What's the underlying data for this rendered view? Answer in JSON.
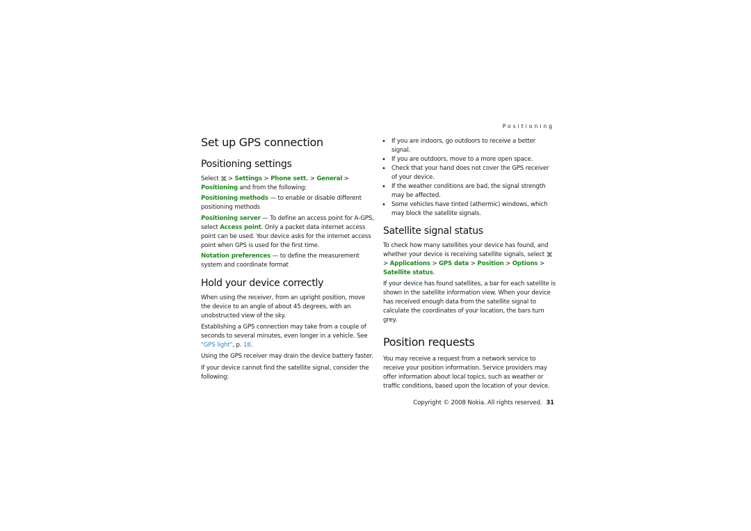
{
  "running_head": "Positioning",
  "left": {
    "title": "Set up GPS connection",
    "positioning_settings": {
      "heading": "Positioning settings",
      "select_word": "Select",
      "menu_icon": "menu-key-icon",
      "sep": ">",
      "path": [
        "Settings",
        "Phone sett.",
        "General",
        "Positioning"
      ],
      "path_tail": "and from the following:",
      "items": [
        {
          "term": "Positioning methods",
          "desc": " — to enable or disable different positioning methods"
        },
        {
          "term": "Positioning server",
          "desc_pre": " — To define an access point for A-GPS, select ",
          "inline_term": "Access point",
          "desc_post": ". Only a packet data internet access point can be used. Your device asks for the internet access point when GPS is used for the first time."
        },
        {
          "term": "Notation preferences",
          "desc": " — to define the measurement system and coordinate format"
        }
      ]
    },
    "hold_device": {
      "heading": "Hold your device correctly",
      "p1": "When using the receiver, from an upright position, move the device to an angle of about 45 degrees, with an unobstructed view of the sky.",
      "p2_pre": "Establishing a GPS connection may take from a couple of seconds to several minutes, even longer in a vehicle. See ",
      "p2_link": "\"GPS light\"",
      "p2_mid": ", p. ",
      "p2_page": "18",
      "p2_end": ".",
      "p3": "Using the GPS receiver may drain the device battery faster.",
      "p4": "If your device cannot find the satellite signal, consider the following:"
    }
  },
  "right": {
    "bullets": [
      "If you are indoors, go outdoors to receive a better signal.",
      "If you are outdoors, move to a more open space.",
      "Check that your hand does not cover the GPS receiver of your device.",
      "If the weather conditions are bad, the signal strength may be affected.",
      "Some vehicles have tinted (athermic) windows, which may block the satellite signals."
    ],
    "satellite": {
      "heading": "Satellite signal status",
      "p1": "To check how many satellites your device has found, and whether your device is receiving satellite signals, select",
      "path": [
        "Applications",
        "GPS data",
        "Position",
        "Options",
        "Satellite status"
      ],
      "p1_end": ".",
      "p2": "If your device has found satellites, a bar for each satellite is shown in the satellite information view. When your device has received enough data from the satellite signal to calculate the coordinates of your location, the bars turn grey."
    },
    "position_requests": {
      "heading": "Position requests",
      "p1": "You may receive a request from a network service to receive your position information. Service providers may offer information about local topics, such as weather or traffic conditions, based upon the location of your device."
    }
  },
  "footer": {
    "copyright": "Copyright © 2008 Nokia. All rights reserved.",
    "page_number": "31"
  },
  "colors": {
    "menu_green": "#1f8a1f",
    "link_blue": "#2a86c8"
  }
}
